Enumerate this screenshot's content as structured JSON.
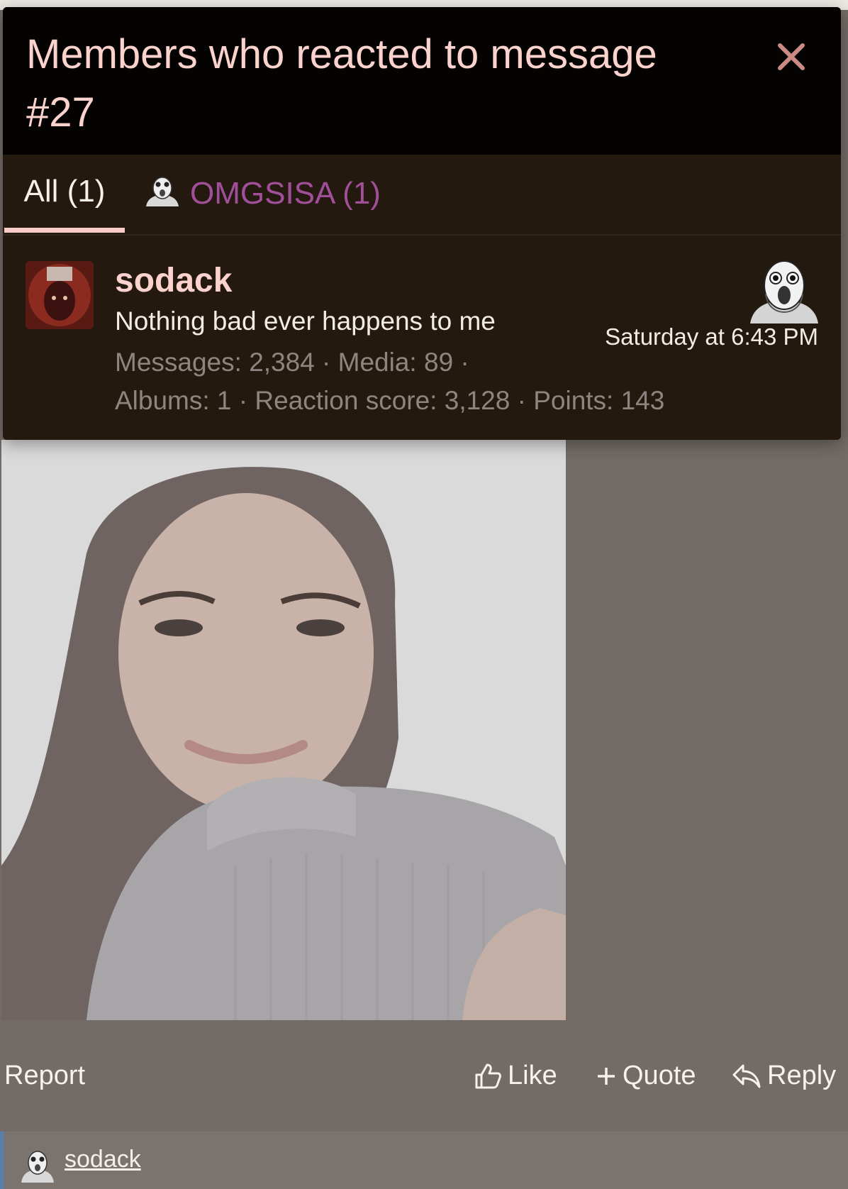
{
  "modal": {
    "title": "Members who reacted to message #27",
    "tabs": [
      {
        "label": "All (1)",
        "active": true
      },
      {
        "label": "OMGSISA (1)",
        "icon": "omgsisa-reaction-icon",
        "color": "#a24f9a"
      }
    ]
  },
  "member": {
    "name": "sodack",
    "user_title": "Nothing bad ever happens to me",
    "stats_line1": "Messages: 2,384 · Media: 89 ·",
    "stats_line2": "Albums: 1 · Reaction score: 3,128 · Points: 143",
    "reaction_time": "Saturday at 6:43 PM",
    "reaction_icon": "omgsisa-reaction-icon"
  },
  "post_actions": {
    "report": "Report",
    "like": "Like",
    "quote": "Quote",
    "reply": "Reply"
  },
  "reaction_summary": {
    "user": "sodack"
  },
  "colors": {
    "accent": "#f8ccc6",
    "reaction_purple": "#a24f9a",
    "modal_bg": "#24190f",
    "header_bg": "#050302",
    "page_bg": "#736b66"
  }
}
